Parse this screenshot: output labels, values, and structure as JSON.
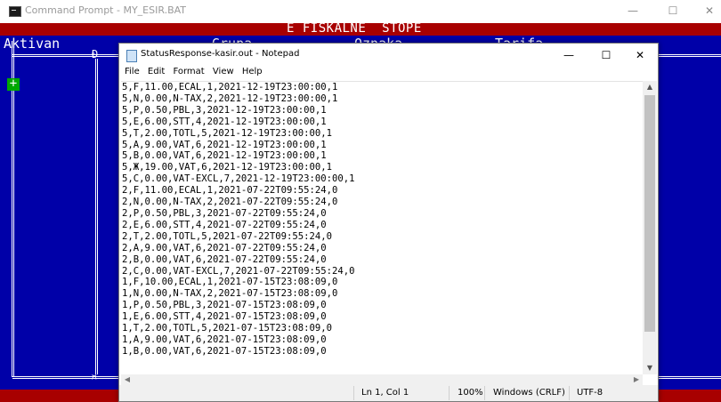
{
  "cmd_window": {
    "title": "Command Prompt - MY_ESIR.BAT",
    "minimize_glyph": "—",
    "maximize_glyph": "☐",
    "close_glyph": "✕"
  },
  "console": {
    "title": "E FISKALNE  STOPE",
    "col_aktivan": "Aktivan",
    "col_grupa": "Grupa",
    "col_oznaka": "Oznaka",
    "col_tarifa": "Tarifa",
    "plus_glyph": "+",
    "junction_top": "Ð",
    "junction_bottom": "¤",
    "colors": {
      "background": "#0000a8",
      "band": "#a80000",
      "active_plus": "#00a800"
    }
  },
  "notepad": {
    "title": "StatusResponse-kasir.out - Notepad",
    "minimize_glyph": "—",
    "maximize_glyph": "☐",
    "close_glyph": "✕",
    "menu": [
      "File",
      "Edit",
      "Format",
      "View",
      "Help"
    ],
    "lines": [
      "5,F,11.00,ECAL,1,2021-12-19T23:00:00,1",
      "5,N,0.00,N-TAX,2,2021-12-19T23:00:00,1",
      "5,P,0.50,PBL,3,2021-12-19T23:00:00,1",
      "5,E,6.00,STT,4,2021-12-19T23:00:00,1",
      "5,T,2.00,TOTL,5,2021-12-19T23:00:00,1",
      "5,A,9.00,VAT,6,2021-12-19T23:00:00,1",
      "5,В,0.00,VAT,6,2021-12-19T23:00:00,1",
      "5,Ж,19.00,VAT,6,2021-12-19T23:00:00,1",
      "5,C,0.00,VAT-EXCL,7,2021-12-19T23:00:00,1",
      "2,F,11.00,ECAL,1,2021-07-22T09:55:24,0",
      "2,N,0.00,N-TAX,2,2021-07-22T09:55:24,0",
      "2,P,0.50,PBL,3,2021-07-22T09:55:24,0",
      "2,E,6.00,STT,4,2021-07-22T09:55:24,0",
      "2,T,2.00,TOTL,5,2021-07-22T09:55:24,0",
      "2,A,9.00,VAT,6,2021-07-22T09:55:24,0",
      "2,B,0.00,VAT,6,2021-07-22T09:55:24,0",
      "2,C,0.00,VAT-EXCL,7,2021-07-22T09:55:24,0",
      "1,F,10.00,ECAL,1,2021-07-15T23:08:09,0",
      "1,N,0.00,N-TAX,2,2021-07-15T23:08:09,0",
      "1,P,0.50,PBL,3,2021-07-15T23:08:09,0",
      "1,E,6.00,STT,4,2021-07-15T23:08:09,0",
      "1,T,2.00,TOTL,5,2021-07-15T23:08:09,0",
      "1,A,9.00,VAT,6,2021-07-15T23:08:09,0",
      "1,B,0.00,VAT,6,2021-07-15T23:08:09,0"
    ],
    "scroll_up_glyph": "▲",
    "scroll_down_glyph": "▼",
    "scroll_left_glyph": "◀",
    "scroll_right_glyph": "▶",
    "status": {
      "position": "Ln 1, Col 1",
      "zoom": "100%",
      "line_ending": "Windows (CRLF)",
      "encoding": "UTF-8"
    }
  }
}
